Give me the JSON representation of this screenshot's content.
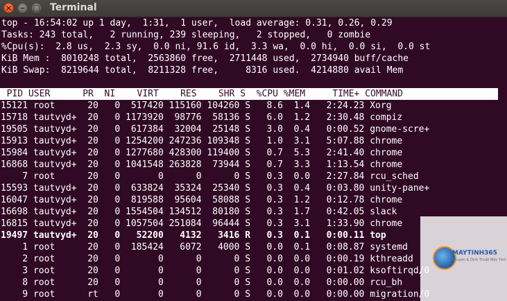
{
  "window": {
    "title": "Terminal",
    "close_glyph": "×",
    "min_glyph": "–",
    "max_glyph": "▢"
  },
  "summary": {
    "line1": "top - 16:54:02 up 1 day,  1:31,  1 user,  load average: 0.31, 0.26, 0.29",
    "line2": "Tasks: 243 total,   2 running, 239 sleeping,   2 stopped,   0 zombie",
    "line3": "%Cpu(s):  2.8 us,  2.3 sy,  0.0 ni, 91.6 id,  3.3 wa,  0.0 hi,  0.0 si,  0.0 st",
    "line4": "KiB Mem :  8010248 total,  2563860 free,  2711448 used,  2734940 buff/cache",
    "line5": "KiB Swap:  8219644 total,  8211328 free,     8316 used.  4214880 avail Mem"
  },
  "header": "  PID USER      PR  NI    VIRT    RES    SHR S  %CPU %MEM     TIME+ COMMAND",
  "rows": [
    "15121 root      20   0  517420 115160 104260 S   8.6  1.4   2:24.23 Xorg",
    "15718 tautvyd+  20   0 1173920  98776  58136 S   6.0  1.2   2:30.48 compiz",
    "19505 tautvyd+  20   0  617384  32004  25148 S   3.0  0.4   0:00.52 gnome-scre+",
    "15913 tautvyd+  20   0 1254200 247236 109348 S   1.0  3.1   5:07.88 chrome",
    "15984 tautvyd+  20   0 1277680 428300 119400 S   0.7  5.3   2:41.40 chrome",
    "16868 tautvyd+  20   0 1041548 263828  73944 S   0.7  3.3   1:13.54 chrome",
    "    7 root      20   0       0      0      0 S   0.3  0.0   2:27.84 rcu_sched",
    "15593 tautvyd+  20   0  633824  35324  25340 S   0.3  0.4   0:03.80 unity-pane+",
    "16047 tautvyd+  20   0  819588  95604  58088 S   0.3  1.2   0:12.78 chrome",
    "16698 tautvyd+  20   0 1554504 134512  80180 S   0.3  1.7   0:42.05 slack",
    "16815 tautvyd+  20   0 1057504 251084  96444 S   0.3  3.1   1:33.90 chrome",
    "19497 tautvyd+  20   0   52200   4132   3416 R   0.3  0.1   0:00.11 top",
    "    1 root      20   0  185424   6072   4000 S   0.0  0.1   0:08.87 systemd",
    "    2 root      20   0       0      0      0 S   0.0  0.0   0:00.19 kthreadd",
    "    3 root      20   0       0      0      0 S   0.0  0.0   0:01.02 ksoftirqd/0",
    "    8 root      20   0       0      0      0 S   0.0  0.0   0:00.00 rcu_bh",
    "    9 root      rt   0       0      0      0 S   0.0  0.0   0:00.00 migration/0"
  ],
  "bold_row_index": 11,
  "watermark": {
    "name": "MAYTINH365",
    "sub": "Chuyên & Dịch Thuật Máy Tính"
  }
}
